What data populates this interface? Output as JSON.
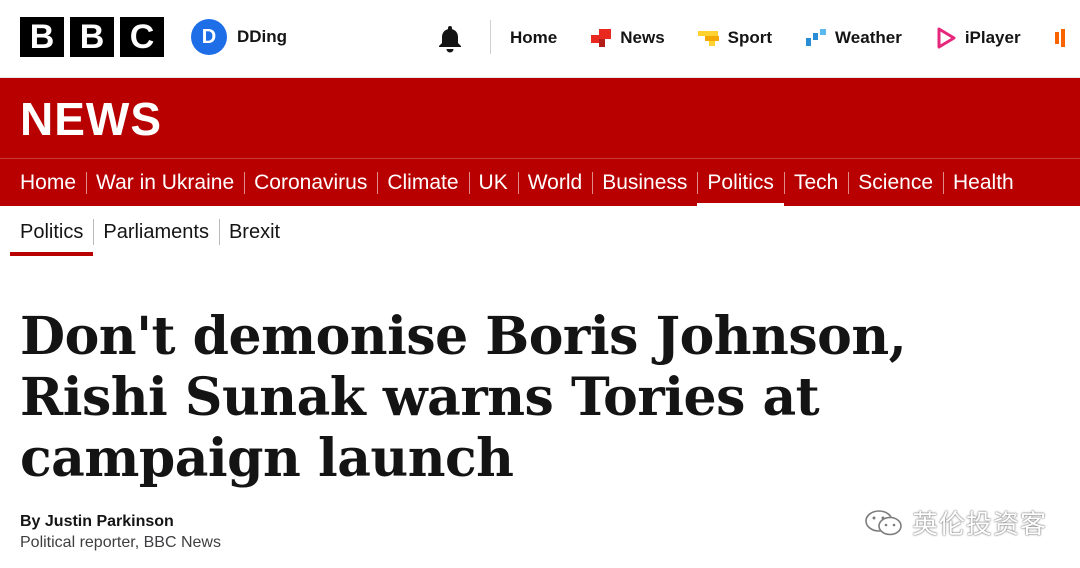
{
  "header": {
    "logo_letters": [
      "B",
      "B",
      "C"
    ],
    "account": {
      "initial": "D",
      "name": "DDing",
      "avatar_color": "#1e6ee8"
    },
    "nav": [
      {
        "label": "Home",
        "icon": "none"
      },
      {
        "label": "News",
        "icon": "news-icon",
        "color": "#e9281f"
      },
      {
        "label": "Sport",
        "icon": "sport-icon",
        "color": "#ffd230"
      },
      {
        "label": "Weather",
        "icon": "weather-icon",
        "color": "#2b8cd6"
      },
      {
        "label": "iPlayer",
        "icon": "iplayer-icon",
        "color": "#e5287b"
      }
    ]
  },
  "banner": {
    "title": "NEWS",
    "brand_color": "#b80000"
  },
  "sections": [
    "Home",
    "War in Ukraine",
    "Coronavirus",
    "Climate",
    "UK",
    "World",
    "Business",
    "Politics",
    "Tech",
    "Science",
    "Health"
  ],
  "active_section": "Politics",
  "subsections": [
    "Politics",
    "Parliaments",
    "Brexit"
  ],
  "active_subsection": "Politics",
  "article": {
    "headline": "Don't demonise Boris Johnson, Rishi Sunak warns Tories at campaign launch",
    "author": "By Justin Parkinson",
    "role": "Political reporter, BBC News"
  },
  "watermark": {
    "text": "英伦投资客"
  }
}
